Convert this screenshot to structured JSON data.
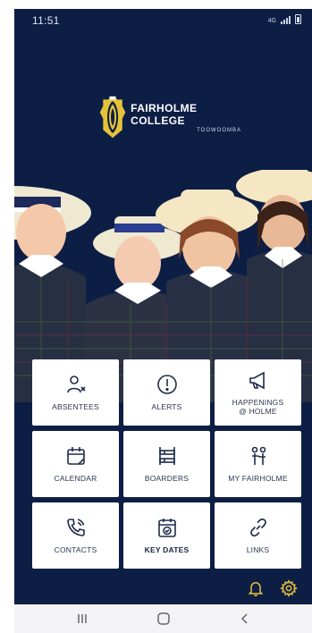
{
  "status_bar": {
    "time": "11:51",
    "network": "4G"
  },
  "logo": {
    "title": "FAIRHOLME COLLEGE",
    "subtitle": "TOOWOOMBA"
  },
  "tiles": [
    {
      "label": "ABSENTEES",
      "icon": "absentee-person-icon"
    },
    {
      "label": "ALERTS",
      "icon": "alert-icon"
    },
    {
      "label_line1": "HAPPENINGS",
      "label_line2": "@ HOLME",
      "icon": "megaphone-icon"
    },
    {
      "label": "CALENDAR",
      "icon": "calendar-icon"
    },
    {
      "label": "BOARDERS",
      "icon": "bunk-bed-icon"
    },
    {
      "label": "MY FAIRHOLME",
      "icon": "people-icon"
    },
    {
      "label": "CONTACTS",
      "icon": "phone-icon"
    },
    {
      "label": "KEY DATES",
      "icon": "calendar-check-icon"
    },
    {
      "label": "LINKS",
      "icon": "link-icon"
    }
  ],
  "bottom_icons": [
    "bell-icon",
    "gear-icon"
  ],
  "nav": [
    "recent-apps-icon",
    "home-icon",
    "back-icon"
  ],
  "colors": {
    "background": "#0d1e45",
    "tile": "#ffffff",
    "accent": "#e6c23a"
  }
}
